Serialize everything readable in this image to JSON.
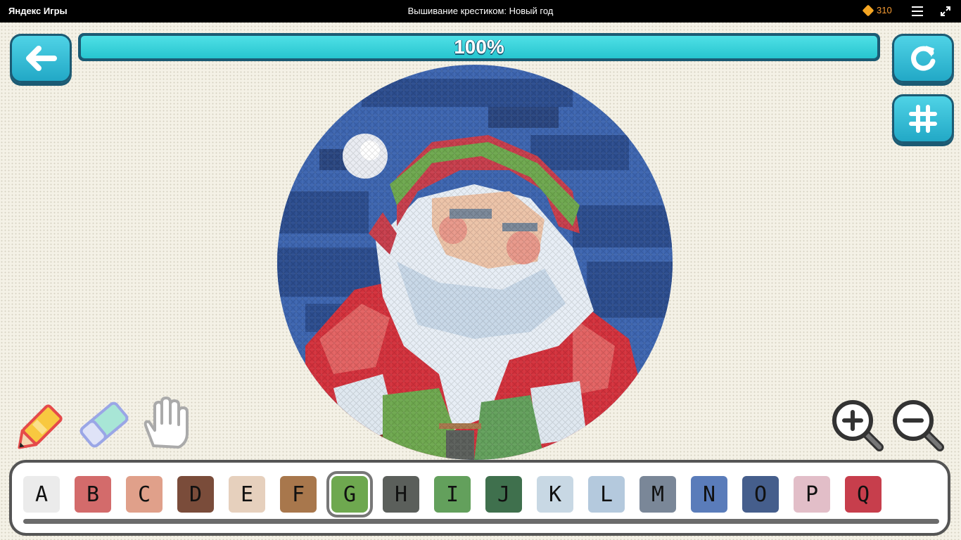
{
  "topbar": {
    "brand": "Яндекс Игры",
    "title": "Вышивание крестиком: Новый год",
    "coins": "310",
    "coin_icon": "gem-icon",
    "menu_icon": "hamburger-menu-icon",
    "fullscreen_icon": "fullscreen-icon"
  },
  "progress": {
    "label": "100%",
    "value": 1.0
  },
  "buttons": {
    "back_icon": "arrow-left-icon",
    "reset_icon": "restart-icon",
    "grid_icon": "grid-hash-icon"
  },
  "tools": [
    "pencil-icon",
    "eraser-icon",
    "hand-icon"
  ],
  "zoom": [
    "zoom-in-icon",
    "zoom-out-icon"
  ],
  "palette": {
    "selected": "G",
    "colors": [
      {
        "letter": "A",
        "color": "#ebebeb"
      },
      {
        "letter": "B",
        "color": "#d36b6b"
      },
      {
        "letter": "C",
        "color": "#e0a08a"
      },
      {
        "letter": "D",
        "color": "#7a4c3a"
      },
      {
        "letter": "E",
        "color": "#e6d0bd"
      },
      {
        "letter": "F",
        "color": "#a8774c"
      },
      {
        "letter": "G",
        "color": "#6ea84f"
      },
      {
        "letter": "H",
        "color": "#5b5f5b"
      },
      {
        "letter": "I",
        "color": "#63a05c"
      },
      {
        "letter": "J",
        "color": "#3f704d"
      },
      {
        "letter": "K",
        "color": "#c8d8e4"
      },
      {
        "letter": "L",
        "color": "#b4c9dd"
      },
      {
        "letter": "M",
        "color": "#7a8798"
      },
      {
        "letter": "N",
        "color": "#5a7cba"
      },
      {
        "letter": "O",
        "color": "#455e8c"
      },
      {
        "letter": "P",
        "color": "#e2bec8"
      },
      {
        "letter": "Q",
        "color": "#c73e4c"
      }
    ]
  }
}
